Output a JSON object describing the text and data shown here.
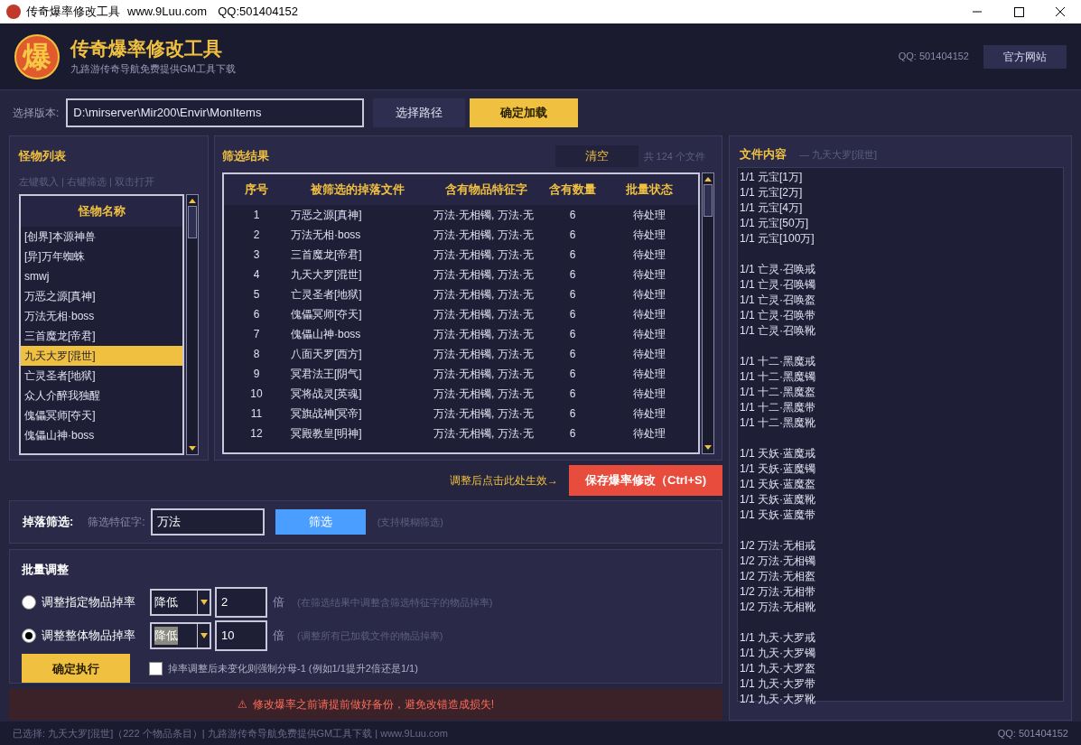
{
  "window": {
    "title": "传奇爆率修改工具",
    "site": "www.9Luu.com",
    "qq": "QQ:501404152"
  },
  "header": {
    "title": "传奇爆率修改工具",
    "subtitle": "九路游传奇导航免费提供GM工具下载",
    "qq": "QQ: 501404152",
    "website_button": "官方网站",
    "logo_glyph": "爆"
  },
  "path_bar": {
    "label": "选择版本:",
    "value": "D:\\mirserver\\Mir200\\Envir\\MonItems",
    "browse_button": "选择路径",
    "load_button": "确定加载"
  },
  "monster_list": {
    "title": "怪物列表",
    "hint": "左键载入 | 右键筛选 | 双击打开",
    "column": "怪物名称",
    "items": [
      {
        "name": "[创界]本源神兽",
        "selected": false
      },
      {
        "name": "[异]万年蜘蛛",
        "selected": false
      },
      {
        "name": "smwj",
        "selected": false
      },
      {
        "name": "万恶之源[真神]",
        "selected": false
      },
      {
        "name": "万法无相·boss",
        "selected": false
      },
      {
        "name": "三首魔龙[帝君]",
        "selected": false
      },
      {
        "name": "九天大罗[混世]",
        "selected": true
      },
      {
        "name": "亡灵圣者[地狱]",
        "selected": false
      },
      {
        "name": "众人介醉我独醒",
        "selected": false
      },
      {
        "name": "傀儡冥师[夺天]",
        "selected": false
      },
      {
        "name": "傀儡山神·boss",
        "selected": false
      }
    ]
  },
  "results": {
    "title": "筛选结果",
    "clear_button": "清空",
    "count": "共 124 个文件",
    "columns": [
      "序号",
      "被筛选的掉落文件",
      "含有物品特征字",
      "含有数量",
      "批量状态"
    ],
    "rows": [
      [
        "1",
        "万恶之源[真神]",
        "万法·无相镯, 万法·无",
        "6",
        "待处理"
      ],
      [
        "2",
        "万法无相·boss",
        "万法·无相镯, 万法·无",
        "6",
        "待处理"
      ],
      [
        "3",
        "三首魔龙[帝君]",
        "万法·无相镯, 万法·无",
        "6",
        "待处理"
      ],
      [
        "4",
        "九天大罗[混世]",
        "万法·无相镯, 万法·无",
        "6",
        "待处理"
      ],
      [
        "5",
        "亡灵圣者[地狱]",
        "万法·无相镯, 万法·无",
        "6",
        "待处理"
      ],
      [
        "6",
        "傀儡冥师[夺天]",
        "万法·无相镯, 万法·无",
        "6",
        "待处理"
      ],
      [
        "7",
        "傀儡山神·boss",
        "万法·无相镯, 万法·无",
        "6",
        "待处理"
      ],
      [
        "8",
        "八面天罗[西方]",
        "万法·无相镯, 万法·无",
        "6",
        "待处理"
      ],
      [
        "9",
        "冥君法王[阴气]",
        "万法·无相镯, 万法·无",
        "6",
        "待处理"
      ],
      [
        "10",
        "冥将战灵[英魂]",
        "万法·无相镯, 万法·无",
        "6",
        "待处理"
      ],
      [
        "11",
        "冥旗战神[冥帝]",
        "万法·无相镯, 万法·无",
        "6",
        "待处理"
      ],
      [
        "12",
        "冥殿教皇[明神]",
        "万法·无相镯, 万法·无",
        "6",
        "待处理"
      ]
    ]
  },
  "save": {
    "hint": "调整后点击此处生效→",
    "button": "保存爆率修改（Ctrl+S)"
  },
  "filter": {
    "title": "掉落筛选:",
    "label": "筛选特征字:",
    "value": "万法",
    "button": "筛选",
    "hint": "(支持模糊筛选)"
  },
  "batch": {
    "title": "批量调整",
    "options": [
      {
        "label": "调整指定物品掉率",
        "selected": false,
        "mode": "降低",
        "mode_highlighted": false,
        "factor": "2",
        "unit": "倍",
        "hint": "(在筛选结果中调整含筛选特征字的物品掉率)"
      },
      {
        "label": "调整整体物品掉率",
        "selected": true,
        "mode": "降低",
        "mode_highlighted": true,
        "factor": "10",
        "unit": "倍",
        "hint": "(调整所有已加载文件的物品掉率)"
      }
    ],
    "execute_button": "确定执行",
    "force_option": {
      "label": "掉率调整后未变化则强制分母-1 (例如1/1提升2倍还是1/1)",
      "checked": false
    }
  },
  "warning": {
    "icon": "⚠",
    "text": "修改爆率之前请提前做好备份，避免改错造成损失!"
  },
  "file_content": {
    "title": "文件内容",
    "subtitle": "— 九天大罗[混世]",
    "groups": [
      [
        "1/1 元宝[1万]",
        "1/1 元宝[2万]",
        "1/1 元宝[4万]",
        "1/1 元宝[50万]",
        "1/1 元宝[100万]"
      ],
      [
        "1/1 亡灵·召唤戒",
        "1/1 亡灵·召唤镯",
        "1/1 亡灵·召唤盔",
        "1/1 亡灵·召唤带",
        "1/1 亡灵·召唤靴"
      ],
      [
        "1/1 十二·黑魔戒",
        "1/1 十二·黑魔镯",
        "1/1 十二·黑魔盔",
        "1/1 十二·黑魔带",
        "1/1 十二·黑魔靴"
      ],
      [
        "1/1 天妖·蓝魔戒",
        "1/1 天妖·蓝魔镯",
        "1/1 天妖·蓝魔盔",
        "1/1 天妖·蓝魔靴",
        "1/1 天妖·蓝魔带"
      ],
      [
        "1/2 万法·无相戒",
        "1/2 万法·无相镯",
        "1/2 万法·无相盔",
        "1/2 万法·无相带",
        "1/2 万法·无相靴"
      ],
      [
        "1/1 九天·大罗戒",
        "1/1 九天·大罗镯",
        "1/1 九天·大罗盔",
        "1/1 九天·大罗带",
        "1/1 九天·大罗靴"
      ]
    ]
  },
  "status_bar": {
    "text": "已选择: 九天大罗[混世]（222 个物品条目）| 九路游传奇导航免费提供GM工具下载 | www.9Luu.com",
    "qq": "QQ: 501404152"
  }
}
